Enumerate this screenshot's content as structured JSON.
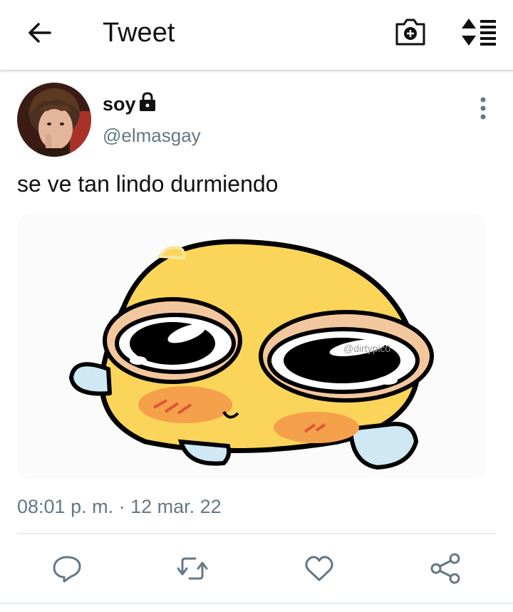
{
  "header": {
    "title": "Tweet",
    "back_icon": "arrow-left-icon",
    "camera_icon": "camera-plus-icon",
    "sort_icon": "sort-list-icon"
  },
  "tweet": {
    "author": {
      "name": "soy",
      "handle": "@elmasgay",
      "protected_icon": "lock-icon"
    },
    "text": "se ve tan lindo durmiendo",
    "media": {
      "type": "image",
      "watermark": "@dirtypic0"
    },
    "timestamp": "08:01 p. m. · 12 mar. 22",
    "actions": [
      "reply-icon",
      "retweet-icon",
      "like-icon",
      "share-icon"
    ]
  },
  "colors": {
    "text_primary": "#111111",
    "text_secondary": "#657786",
    "icon": "#657786",
    "divider": "#e6ecf0"
  }
}
